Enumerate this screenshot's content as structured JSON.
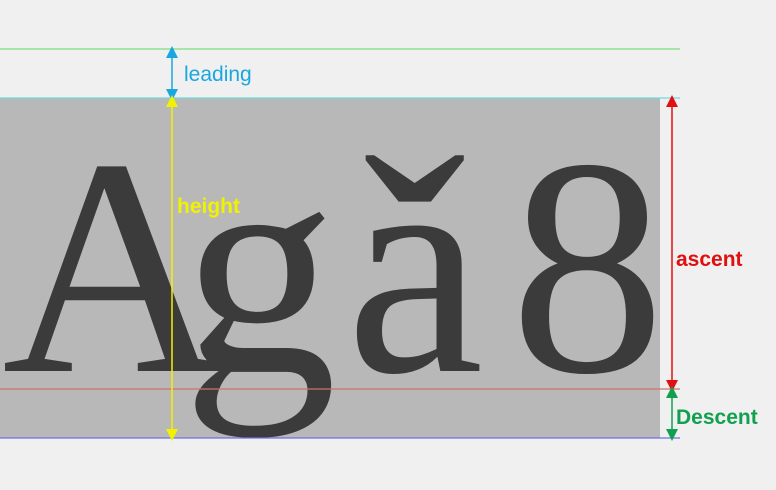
{
  "sample_text": {
    "glyphs": [
      "A",
      "g",
      "ǎ",
      "8"
    ]
  },
  "metrics": {
    "leading": {
      "label": "leading",
      "color": "#1aa7e0"
    },
    "height": {
      "label": "height",
      "color": "#f2f200"
    },
    "ascent": {
      "label": "ascent",
      "color": "#e01010"
    },
    "descent": {
      "label": "Descent",
      "color": "#10a050"
    }
  },
  "lines": {
    "top_color": "#7ddc7d",
    "ascent_top_color": "#6fd8e0",
    "baseline_color": "#d07070",
    "bottom_color": "#6f6fe0"
  },
  "colors": {
    "background": "#f0f0f0",
    "glyph_box": "#b8b8b8",
    "glyph": "#3b3b3b"
  }
}
